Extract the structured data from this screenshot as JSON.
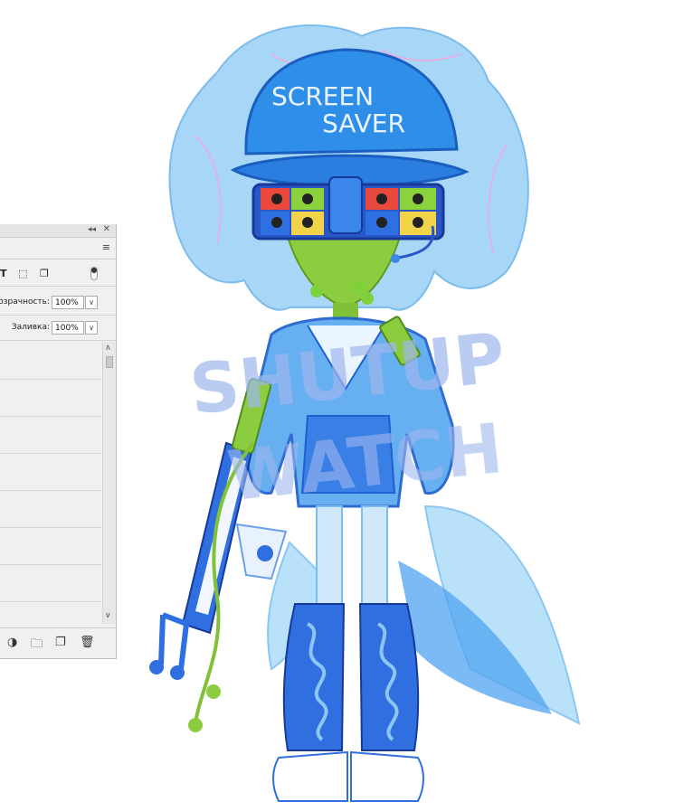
{
  "layers_panel": {
    "opacity_label": "озрачность:",
    "opacity_value": "100%",
    "fill_label": "Заливка:",
    "fill_value": "100%",
    "filter_icons": [
      "text-filter-icon",
      "shape-filter-icon",
      "smart-object-filter-icon"
    ],
    "footer_icons": [
      "adjustment-layer-icon",
      "new-group-icon",
      "new-layer-icon",
      "delete-icon"
    ]
  },
  "artwork": {
    "cap_text_line1": "SCREEN",
    "cap_text_line2": "SAVER",
    "watermark_line1": "SHUTUP",
    "watermark_line2": "WATCH"
  },
  "colors": {
    "cap_blue": "#2f8fe8",
    "hair_light_blue": "#a8d6f7",
    "skin_green": "#8ccc3f",
    "boot_blue": "#2f6fe0",
    "watermark": "#9fb7ef"
  }
}
